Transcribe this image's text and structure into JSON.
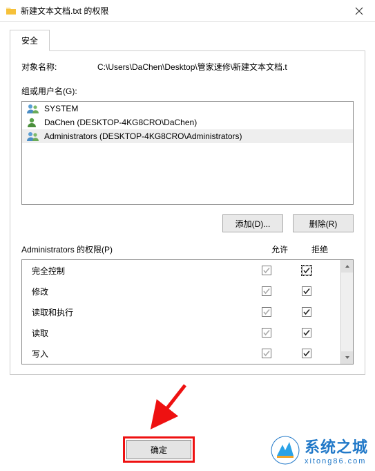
{
  "window": {
    "title": "新建文本文档.txt 的权限"
  },
  "tab": {
    "security": "安全"
  },
  "object": {
    "label": "对象名称:",
    "path": "C:\\Users\\DaChen\\Desktop\\管家速修\\新建文本文档.t"
  },
  "groups": {
    "label": "组或用户名(G):",
    "items": [
      {
        "name": "SYSTEM",
        "type": "group",
        "selected": false
      },
      {
        "name": "DaChen (DESKTOP-4KG8CRO\\DaChen)",
        "type": "user",
        "selected": false
      },
      {
        "name": "Administrators (DESKTOP-4KG8CRO\\Administrators)",
        "type": "group",
        "selected": true
      }
    ]
  },
  "buttons": {
    "add": "添加(D)...",
    "remove": "删除(R)",
    "ok": "确定"
  },
  "perm": {
    "title": "Administrators 的权限(P)",
    "allow": "允许",
    "deny": "拒绝",
    "rows": [
      {
        "name": "完全控制",
        "allow": true,
        "deny": true,
        "active": true
      },
      {
        "name": "修改",
        "allow": true,
        "deny": true,
        "active": false
      },
      {
        "name": "读取和执行",
        "allow": true,
        "deny": true,
        "active": false
      },
      {
        "name": "读取",
        "allow": true,
        "deny": true,
        "active": false
      },
      {
        "name": "写入",
        "allow": true,
        "deny": true,
        "active": false
      }
    ]
  },
  "watermark": {
    "name": "系统之城",
    "url": "xitong86.com"
  }
}
